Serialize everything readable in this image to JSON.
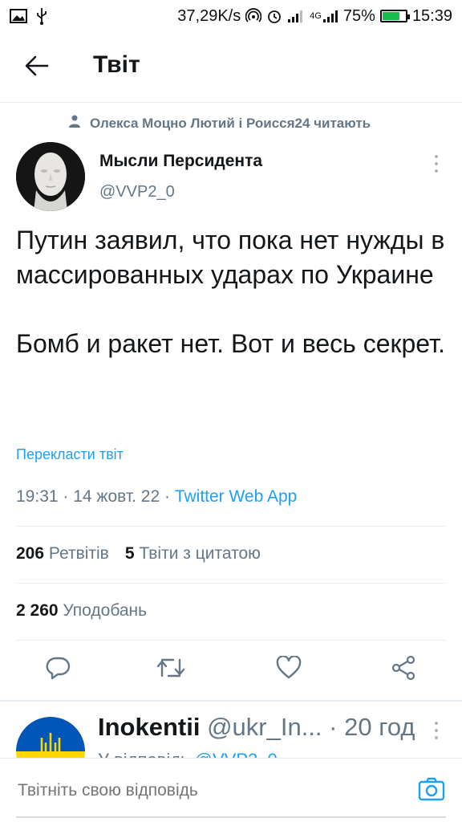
{
  "status_bar": {
    "net_speed": "37,29K/s",
    "network_type": "4G",
    "battery_percent": "75%",
    "battery_level": 0.75,
    "time": "15:39",
    "icons": [
      "image-icon",
      "usb-icon",
      "hotspot-icon",
      "alarm-icon",
      "signal-icon",
      "signal-4g-icon",
      "battery-icon"
    ]
  },
  "header": {
    "title": "Твіт",
    "back_icon": "arrow-left-icon"
  },
  "social_context": {
    "text": "Олекса Моцно Лютий і Роисся24 читають",
    "icon": "person-icon"
  },
  "tweet": {
    "author_name": "Мысли Персидента",
    "author_handle": "@VVP2_0",
    "paragraphs": [
      "Путин заявил, что пока нет нужды в массированных ударах по Украине",
      "Бомб и ракет нет. Вот и весь секрет."
    ],
    "translate_label": "Перекласти твіт",
    "timestamp": "19:31 · 14 жовт. 22 · ",
    "source": "Twitter Web App"
  },
  "stats": {
    "retweets_count": "206",
    "retweets_label": "Ретвітів",
    "quotes_count": "5",
    "quotes_label": "Твіти з цитатою",
    "likes_count": "2 260",
    "likes_label": "Уподобань"
  },
  "actions": [
    "reply-icon",
    "retweet-icon",
    "like-icon",
    "share-icon"
  ],
  "reply": {
    "name": "Inokentii",
    "handle": "@ukr_In...",
    "time": "· 20 год",
    "sub_prefix": "У відповідь",
    "sub_mention": "@VVP2_0"
  },
  "composer": {
    "placeholder": "Твітніть свою відповідь"
  },
  "colors": {
    "accent": "#1da1f2",
    "muted": "#657786",
    "text": "#14171a",
    "border": "#e6ecf0"
  }
}
